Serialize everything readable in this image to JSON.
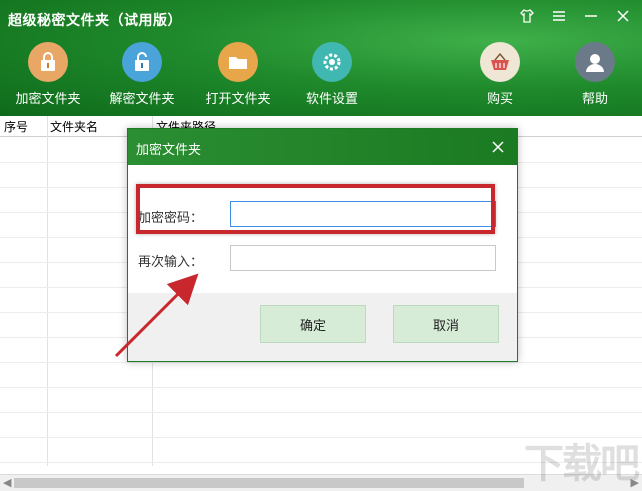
{
  "app": {
    "title": "超级秘密文件夹（试用版）",
    "window_controls": [
      "shirt-icon",
      "menu-icon",
      "minimize-icon",
      "close-icon"
    ]
  },
  "toolbar": {
    "items": [
      {
        "label": "加密文件夹",
        "icon": "lock-closed-icon",
        "color": "#e9a766"
      },
      {
        "label": "解密文件夹",
        "icon": "lock-open-icon",
        "color": "#4aa3d9"
      },
      {
        "label": "打开文件夹",
        "icon": "folder-icon",
        "color": "#e7a64a"
      },
      {
        "label": "软件设置",
        "icon": "gear-icon",
        "color": "#40b7b0"
      },
      {
        "label": "购买",
        "icon": "basket-icon",
        "color": "#f0e6d6"
      },
      {
        "label": "帮助",
        "icon": "user-icon",
        "color": "#6a7a88"
      }
    ]
  },
  "table": {
    "headers": [
      "序号",
      "文件夹名",
      "文件夹路径"
    ]
  },
  "dialog": {
    "title": "加密文件夹",
    "fields": [
      {
        "label": "加密密码：",
        "value": ""
      },
      {
        "label": "再次输入：",
        "value": ""
      }
    ],
    "ok_label": "确定",
    "cancel_label": "取消"
  },
  "colors": {
    "header_green": "#1f8a2c",
    "highlight_red": "#c8282d",
    "button_green": "#d6ecd7"
  },
  "watermark": "下载吧"
}
